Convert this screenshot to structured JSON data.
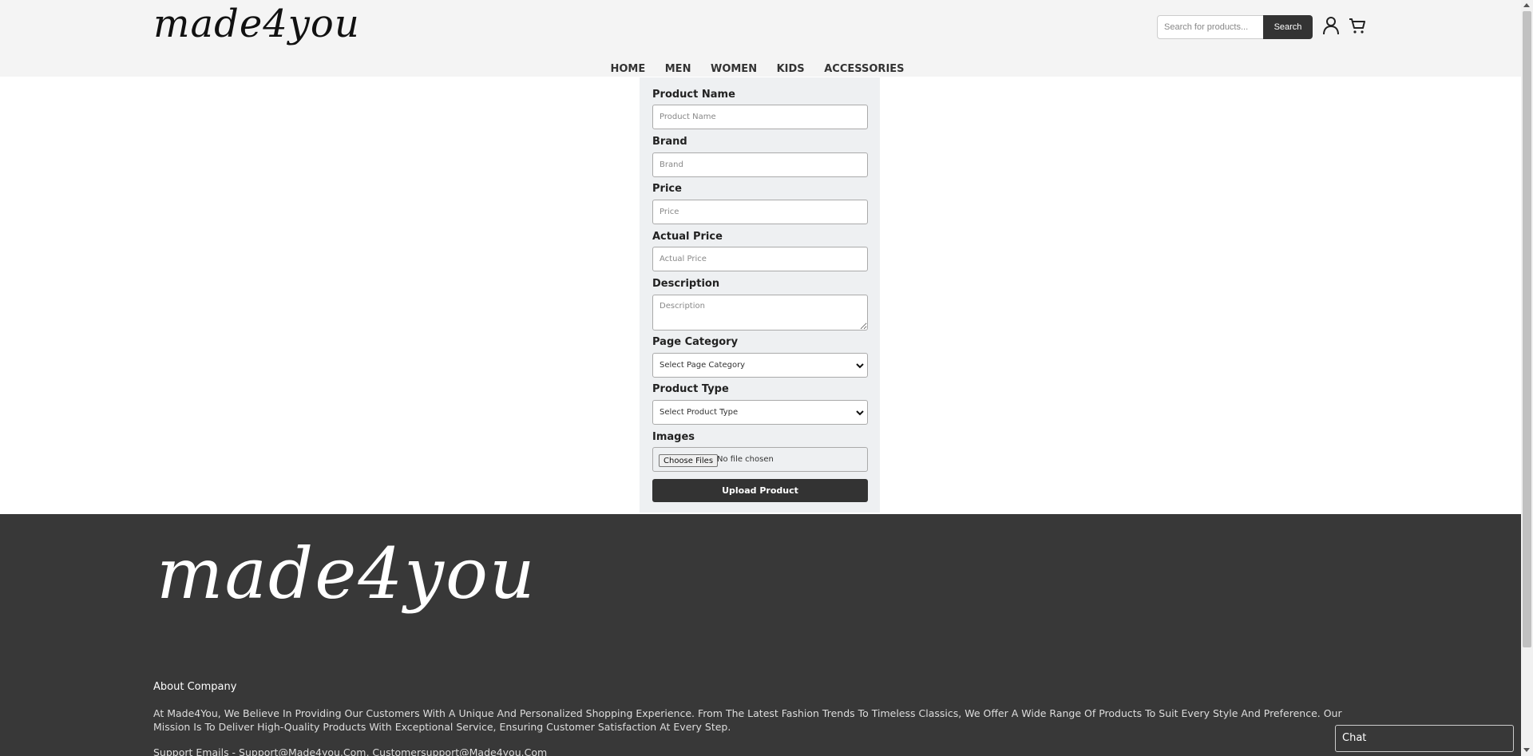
{
  "header": {
    "logo": "made4you",
    "search": {
      "placeholder": "Search for products...",
      "button": "Search"
    },
    "icons": [
      "user-icon",
      "cart-icon"
    ]
  },
  "nav": {
    "items": [
      "HOME",
      "MEN",
      "WOMEN",
      "KIDS",
      "ACCESSORIES"
    ]
  },
  "form": {
    "product_name": {
      "label": "Product Name",
      "placeholder": "Product Name"
    },
    "brand": {
      "label": "Brand",
      "placeholder": "Brand"
    },
    "price": {
      "label": "Price",
      "placeholder": "Price"
    },
    "actual_price": {
      "label": "Actual Price",
      "placeholder": "Actual Price"
    },
    "description": {
      "label": "Description",
      "placeholder": "Description"
    },
    "page_category": {
      "label": "Page Category",
      "selected": "Select Page Category"
    },
    "product_type": {
      "label": "Product Type",
      "selected": "Select Product Type"
    },
    "images": {
      "label": "Images",
      "button": "Choose Files",
      "status": "No file chosen"
    },
    "submit": "Upload Product"
  },
  "footer": {
    "logo": "made4you",
    "about_title": "About Company",
    "about_text": "At Made4You, We Believe In Providing Our Customers With A Unique And Personalized Shopping Experience. From The Latest Fashion Trends To Timeless Classics, We Offer A Wide Range Of Products To Suit Every Style And Preference. Our Mission Is To Deliver High-Quality Products With Exceptional Service, Ensuring Customer Satisfaction At Every Step.",
    "support": "Support Emails - Support@Made4you.Com, Customersupport@Made4you.Com"
  },
  "chat": {
    "label": "Chat"
  },
  "colors": {
    "header_bg": "#f4f4f4",
    "footer_bg": "#383838",
    "button_bg": "#333333",
    "panel_bg": "#eef0f2"
  }
}
